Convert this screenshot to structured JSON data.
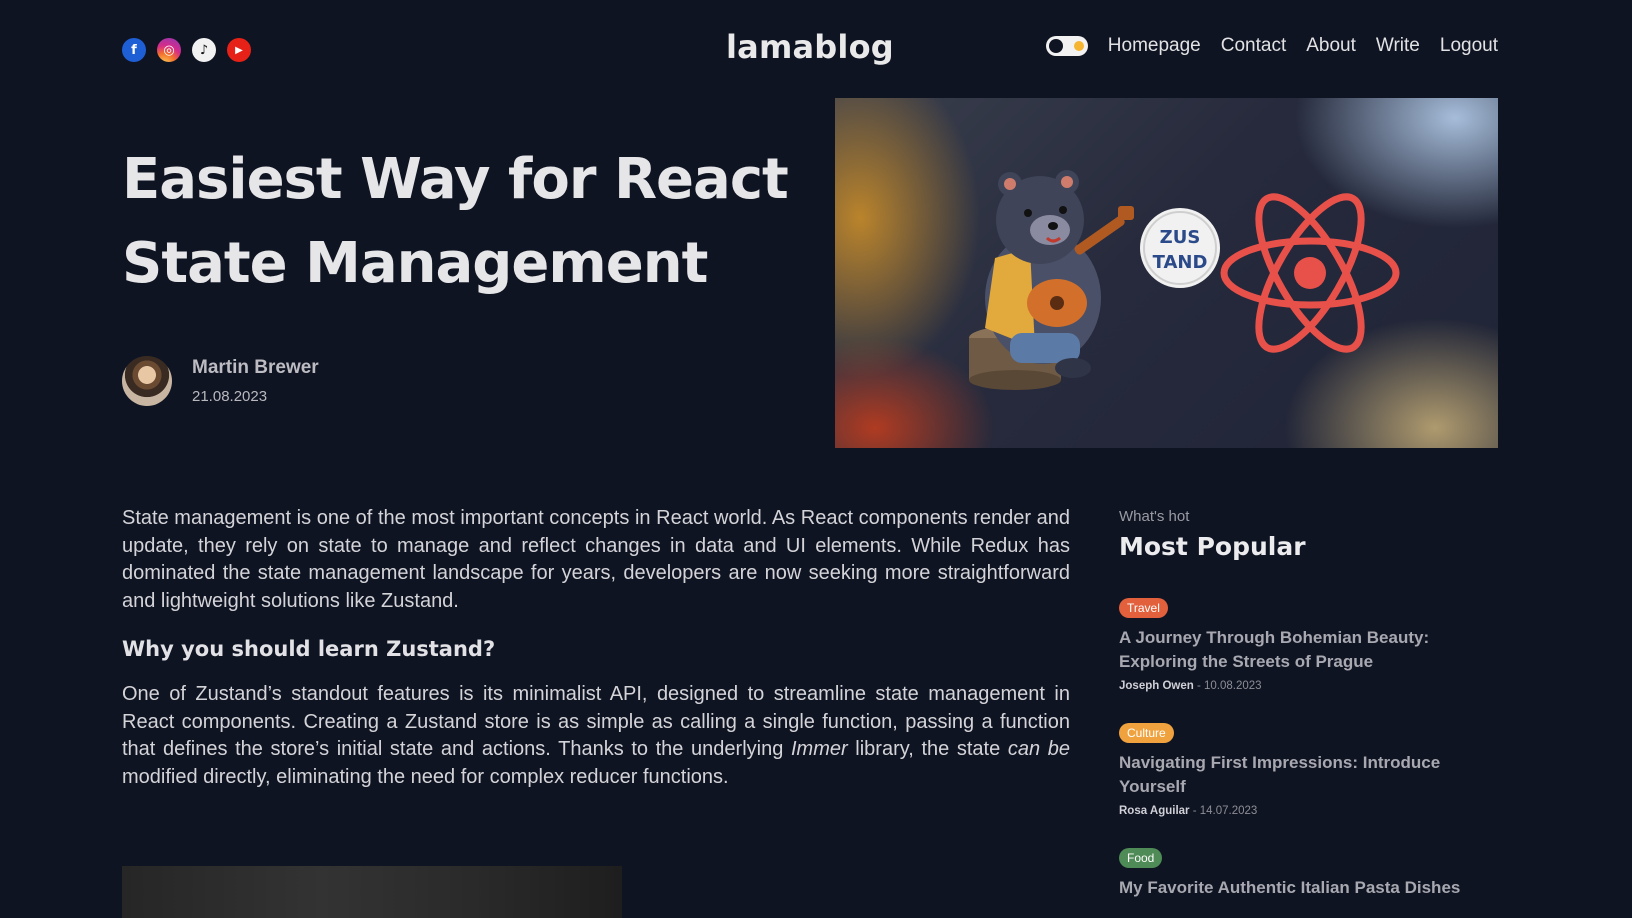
{
  "brand": {
    "name": "lamablog"
  },
  "socials": [
    {
      "name": "facebook",
      "glyph": "f",
      "color": "#1f5fd6"
    },
    {
      "name": "instagram",
      "glyph": "◎",
      "color": "#d52c89"
    },
    {
      "name": "tiktok",
      "glyph": "♪",
      "color": "#f2f2f2"
    },
    {
      "name": "youtube",
      "glyph": "▶",
      "color": "#e62117"
    }
  ],
  "nav": {
    "links": [
      "Homepage",
      "Contact",
      "About",
      "Write",
      "Logout"
    ],
    "theme_toggle": "dark"
  },
  "post": {
    "title_line1": "Easiest Way for React",
    "title_line2": "State Management",
    "author": "Martin Brewer",
    "date": "21.08.2023",
    "hero_image_text": "ZUS TAND",
    "paragraph1": "State management is one of the most important concepts in React world. As React components render and update, they rely on state to manage and reflect changes in data and UI elements. While Redux has dominated the state management landscape for years, developers are now seeking more straightforward and lightweight solutions like Zustand.",
    "subheading": "Why you should learn Zustand?",
    "paragraph2_a": "One of Zustand’s standout features is its minimalist API, designed to streamline state management in React components. Creating a Zustand store is as simple as calling a single function, passing a function that defines the store’s initial state and actions. Thanks to the underlying ",
    "paragraph2_em1": "Immer",
    "paragraph2_b": " library, the state ",
    "paragraph2_em2": "can be",
    "paragraph2_c": " modified directly, eliminating the need for complex reducer functions."
  },
  "sidebar": {
    "kicker": "What's hot",
    "title": "Most Popular",
    "items": [
      {
        "category": "Travel",
        "color": "#e2603c",
        "title": "A Journey Through Bohemian Beauty: Exploring the Streets of Prague",
        "author": "Joseph Owen",
        "date": "10.08.2023"
      },
      {
        "category": "Culture",
        "color": "#f0a23e",
        "title": "Navigating First Impressions: Introduce Yourself",
        "author": "Rosa Aguilar",
        "date": "14.07.2023"
      },
      {
        "category": "Food",
        "color": "#4f8b56",
        "title": "My Favorite Authentic Italian Pasta Dishes",
        "author": "",
        "date": ""
      }
    ]
  }
}
